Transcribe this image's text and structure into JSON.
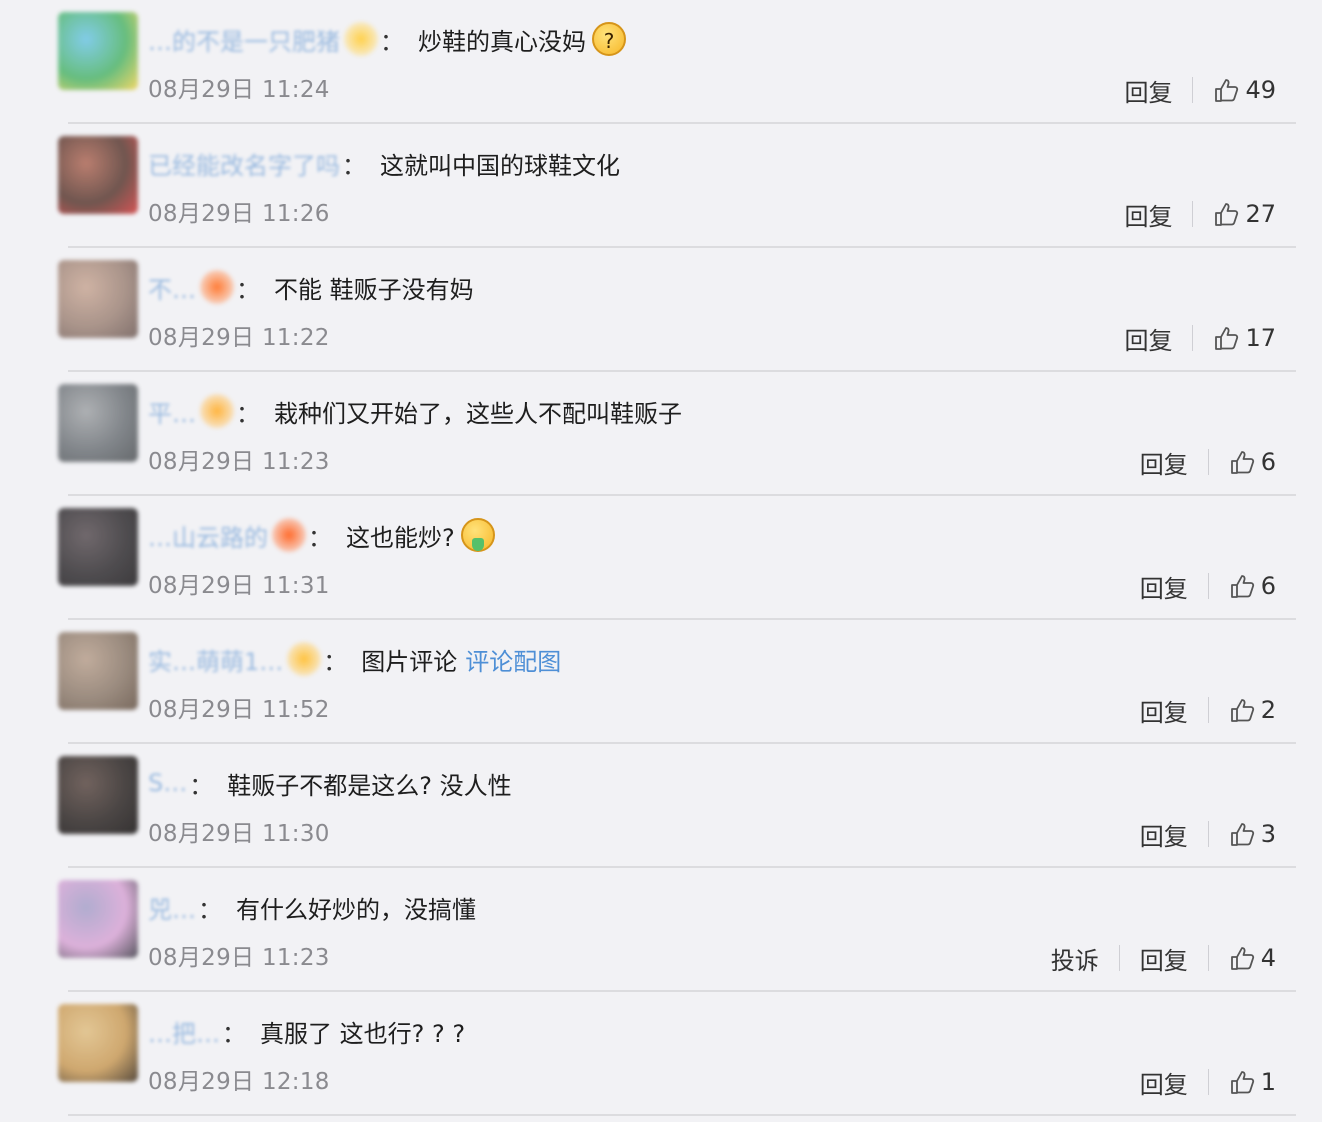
{
  "labels": {
    "reply": "回复",
    "report": "投诉"
  },
  "comments": [
    {
      "username": "…的不是一只肥猪",
      "text": "炒鞋的真心没妈",
      "emoji": "thinking-emoji",
      "timestamp": "08月29日 11:24",
      "likes": "49",
      "avatar_colors": [
        "#4fb56a",
        "#6ec6e6",
        "#f2d34f"
      ],
      "badge_color": "#ffd04a"
    },
    {
      "username": "已经能改名字了吗",
      "text": "这就叫中国的球鞋文化",
      "timestamp": "08月29日 11:26",
      "likes": "27",
      "avatar_colors": [
        "#5a3b33",
        "#b06a58",
        "#d23a3a"
      ],
      "badge_color": ""
    },
    {
      "username": "不…",
      "text": "不能 鞋贩子没有妈",
      "timestamp": "08月29日 11:22",
      "likes": "17",
      "avatar_colors": [
        "#9d8478",
        "#c9a896",
        "#6d5a55"
      ],
      "badge_color": "#ff7b35"
    },
    {
      "username": "平…",
      "text": "栽种们又开始了，这些人不配叫鞋贩子",
      "timestamp": "08月29日 11:23",
      "likes": "6",
      "avatar_colors": [
        "#6e7378",
        "#a2a5a8",
        "#4e5255"
      ],
      "badge_color": "#ffb43d"
    },
    {
      "username": "…山云路的",
      "text": "这也能炒?",
      "emoji": "puke-emoji",
      "timestamp": "08月29日 11:31",
      "likes": "6",
      "avatar_colors": [
        "#333033",
        "#5a5155",
        "#1d1b1d"
      ],
      "badge_color": "#ff6a2b"
    },
    {
      "username": "实…萌萌1…",
      "text": "图片评论",
      "link": "评论配图",
      "timestamp": "08月29日 11:52",
      "likes": "2",
      "avatar_colors": [
        "#8c7a6b",
        "#b8a08d",
        "#645244"
      ],
      "badge_color": "#ffc23d"
    },
    {
      "username": "S…",
      "text": "鞋贩子不都是这么? 没人性",
      "timestamp": "08月29日 11:30",
      "likes": "3",
      "avatar_colors": [
        "#2e2826",
        "#5b4a44",
        "#141111"
      ],
      "badge_color": ""
    },
    {
      "username": "兕…",
      "text": "有什么好炒的，没搞懂",
      "timestamp": "08月29日 11:23",
      "likes": "4",
      "show_report": true,
      "avatar_colors": [
        "#d9a6d6",
        "#a6a1c9",
        "#3b3a44"
      ],
      "badge_color": ""
    },
    {
      "username": "…把…",
      "text": "真服了 这也行? ? ?",
      "timestamp": "08月29日 12:18",
      "likes": "1",
      "avatar_colors": [
        "#c99b58",
        "#e0bf84",
        "#3b2d1d"
      ],
      "badge_color": ""
    }
  ]
}
